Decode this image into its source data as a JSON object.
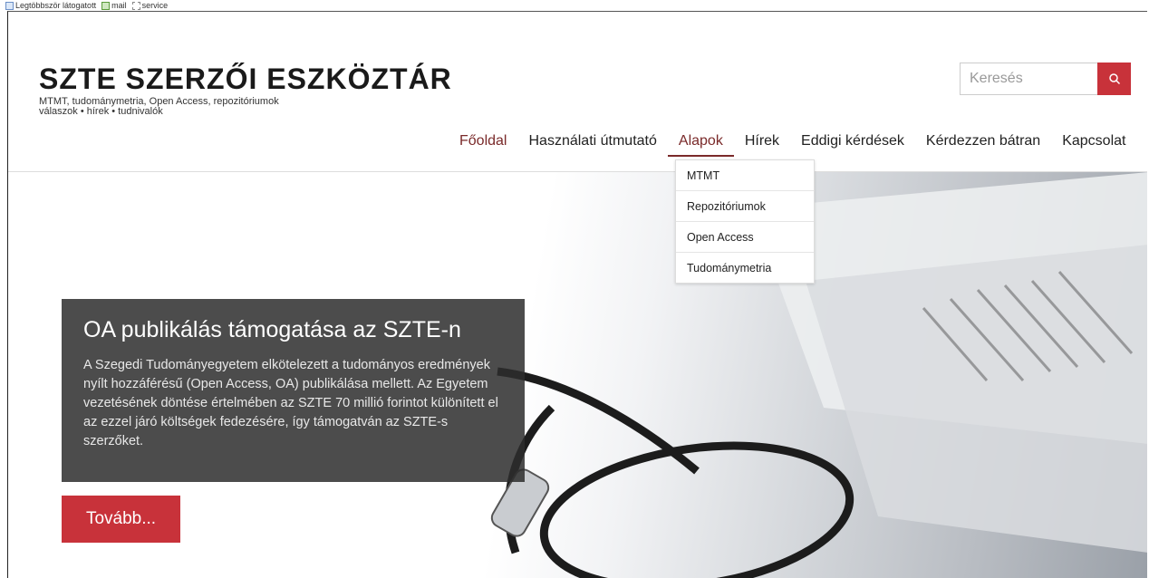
{
  "browser": {
    "bookmarks": [
      {
        "label": "Legtöbbször látogatott",
        "icon": "bookmark-page-icon"
      },
      {
        "label": "mail",
        "icon": "mail-icon"
      },
      {
        "label": "service",
        "icon": "folder-icon"
      }
    ]
  },
  "site": {
    "title": "SZTE SZERZŐI ESZKÖZTÁR",
    "subtitle_line1": "MTMT, tudománymetria, Open Access, repozitóriumok",
    "subtitle_line2": "válaszok • hírek • tudnivalók"
  },
  "search": {
    "placeholder": "Keresés",
    "icon": "search-icon"
  },
  "nav": {
    "items": [
      {
        "label": "Főoldal"
      },
      {
        "label": "Használati útmutató"
      },
      {
        "label": "Alapok"
      },
      {
        "label": "Hírek"
      },
      {
        "label": "Eddigi kérdések"
      },
      {
        "label": "Kérdezzen bátran"
      },
      {
        "label": "Kapcsolat"
      }
    ],
    "active": "Alapok"
  },
  "dropdown": {
    "items": [
      {
        "label": "MTMT"
      },
      {
        "label": "Repozitóriumok"
      },
      {
        "label": "Open Access"
      },
      {
        "label": "Tudománymetria"
      }
    ]
  },
  "hero": {
    "title": "OA publikálás támogatása az SZTE-n",
    "text": "A Szegedi Tudományegyetem elkötelezett a tudományos eredmények nyílt hozzáférésű (Open Access, OA) publikálása mellett. Az Egyetem vezetésének döntése értelmében az SZTE 70 millió forintot különített el az ezzel járó költségek fedezésére, így támogatván az SZTE-s szerzőket.",
    "button_label": "Tovább...",
    "image": "glasses-and-papers-photo"
  },
  "colors": {
    "accent_red": "#c8323a",
    "nav_active": "#7a2a2a",
    "caption_bg": "#2d2d2d"
  }
}
